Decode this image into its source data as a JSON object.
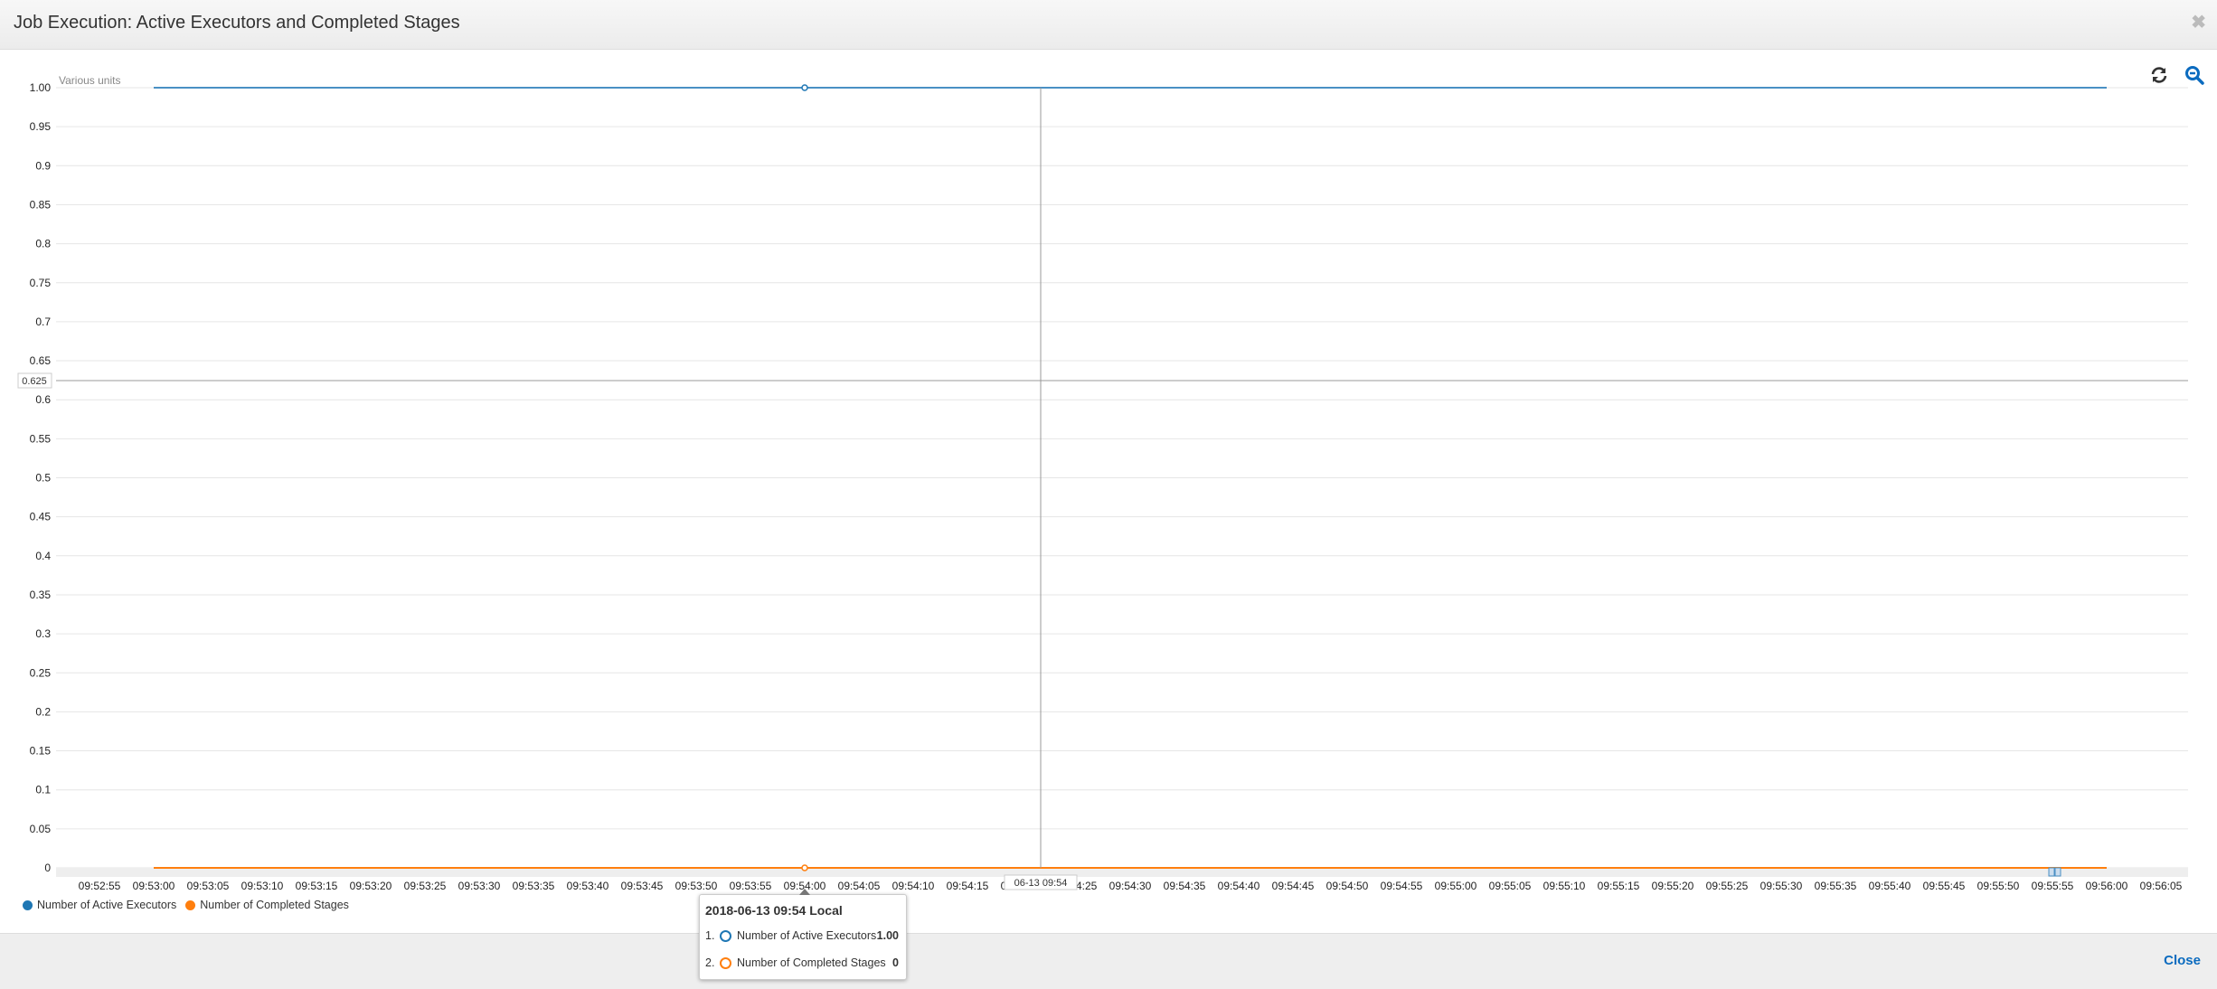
{
  "dialog": {
    "title": "Job Execution: Active Executors and Completed Stages",
    "close_label": "Close"
  },
  "toolbar": {
    "refresh_icon": "refresh-icon",
    "zoom_icon": "zoom-out-icon"
  },
  "colors": {
    "active_executors": "#1f77b4",
    "completed_stages": "#ff7f0e",
    "line_blue": "#4a90c4",
    "accent": "#0b6bbf"
  },
  "crosshair": {
    "y_label": "0.625",
    "x_label": "06-13 09:54"
  },
  "tooltip": {
    "title": "2018-06-13 09:54 Local",
    "rows": [
      {
        "index": "1.",
        "label": "Number of Active Executors",
        "value": "1.00"
      },
      {
        "index": "2.",
        "label": "Number of Completed Stages",
        "value": "0"
      }
    ]
  },
  "chart_data": {
    "type": "line",
    "ylabel": "Various units",
    "ylim": [
      0,
      1
    ],
    "y_ticks": [
      "0",
      "0.05",
      "0.1",
      "0.15",
      "0.2",
      "0.25",
      "0.3",
      "0.35",
      "0.4",
      "0.45",
      "0.5",
      "0.55",
      "0.6",
      "0.65",
      "0.7",
      "0.75",
      "0.8",
      "0.85",
      "0.9",
      "0.95",
      "1.00"
    ],
    "x_ticks": [
      "09:52:55",
      "09:53:00",
      "09:53:05",
      "09:53:10",
      "09:53:15",
      "09:53:20",
      "09:53:25",
      "09:53:30",
      "09:53:35",
      "09:53:40",
      "09:53:45",
      "09:53:50",
      "09:53:55",
      "09:54:00",
      "09:54:05",
      "09:54:10",
      "09:54:15",
      "09:54:20",
      "09:54:25",
      "09:54:30",
      "09:54:35",
      "09:54:40",
      "09:54:45",
      "09:54:50",
      "09:54:55",
      "09:55:00",
      "09:55:05",
      "09:55:10",
      "09:55:15",
      "09:55:20",
      "09:55:25",
      "09:55:30",
      "09:55:35",
      "09:55:40",
      "09:55:45",
      "09:55:50",
      "09:55:55",
      "09:56:00",
      "09:56:05"
    ],
    "grid": true,
    "legend_position": "bottom-left",
    "series": [
      {
        "name": "Number of Active Executors",
        "x": [
          "09:53:00",
          "09:54:00",
          "09:56:00"
        ],
        "y": [
          1,
          1,
          1
        ]
      },
      {
        "name": "Number of Completed Stages",
        "x": [
          "09:53:00",
          "09:54:00",
          "09:56:00"
        ],
        "y": [
          0,
          0,
          0
        ]
      }
    ]
  }
}
